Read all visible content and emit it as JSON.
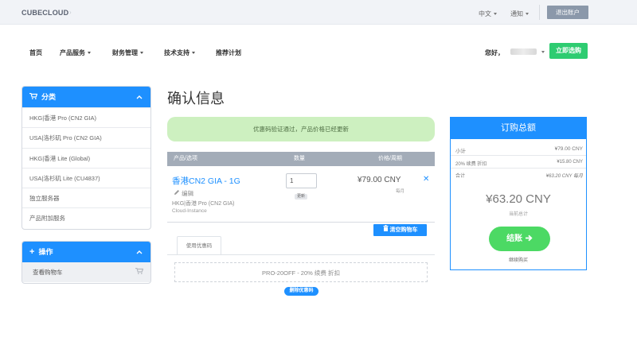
{
  "topbar": {
    "logo": "CUBECLOUD",
    "language": "中文",
    "notifications": "通知",
    "logout": "退出账户"
  },
  "nav": {
    "home": "首页",
    "products": "产品服务",
    "billing": "财务管理",
    "support": "技术支持",
    "affiliates": "推荐计划",
    "greeting": "您好，",
    "buy_now": "立即选购"
  },
  "sidebar": {
    "categories_title": "分类",
    "categories": [
      "HKG|香港 Pro (CN2 GIA)",
      "USA|洛杉矶 Pro (CN2 GIA)",
      "HKG|香港 Lite (Global)",
      "USA|洛杉矶 Lite (CU4837)",
      "独立服务器",
      "产品附加服务"
    ],
    "actions_title": "操作",
    "actions": [
      "查看购物车"
    ]
  },
  "main": {
    "title": "确认信息",
    "alert": "优惠码验证通过，产品价格已经更新",
    "table_headers": {
      "product": "产品/选项",
      "qty": "数量",
      "price": "价格/周期"
    },
    "item": {
      "name": "香港CN2 GIA - 1G",
      "edit": "编辑",
      "group": "HKG|香港 Pro (CN2 GIA)",
      "domain": "Cloud-Instance",
      "qty": "1",
      "update": "更新",
      "price": "¥79.00 CNY",
      "cycle": "每月"
    },
    "empty_cart": "清空购物车",
    "coupon_tab": "使用优惠码",
    "coupon_applied": "PRO-20OFF - 20% 续费 折扣",
    "remove_coupon": "删除优惠码"
  },
  "summary": {
    "title": "订购总额",
    "subtotal_label": "小计",
    "subtotal_value": "¥79.00 CNY",
    "discount_label": "20% 续费 折扣",
    "discount_value": "¥15.80 CNY",
    "total_label": "合计",
    "total_value": "¥63.20 CNY 每月",
    "grand_total": "¥63.20 CNY",
    "grand_total_label": "当前总计",
    "checkout": "结账",
    "continue": "继续购买"
  },
  "colors": {
    "primary": "#1e90ff",
    "success": "#2ecc71",
    "alert_bg": "#cdf0c0"
  }
}
